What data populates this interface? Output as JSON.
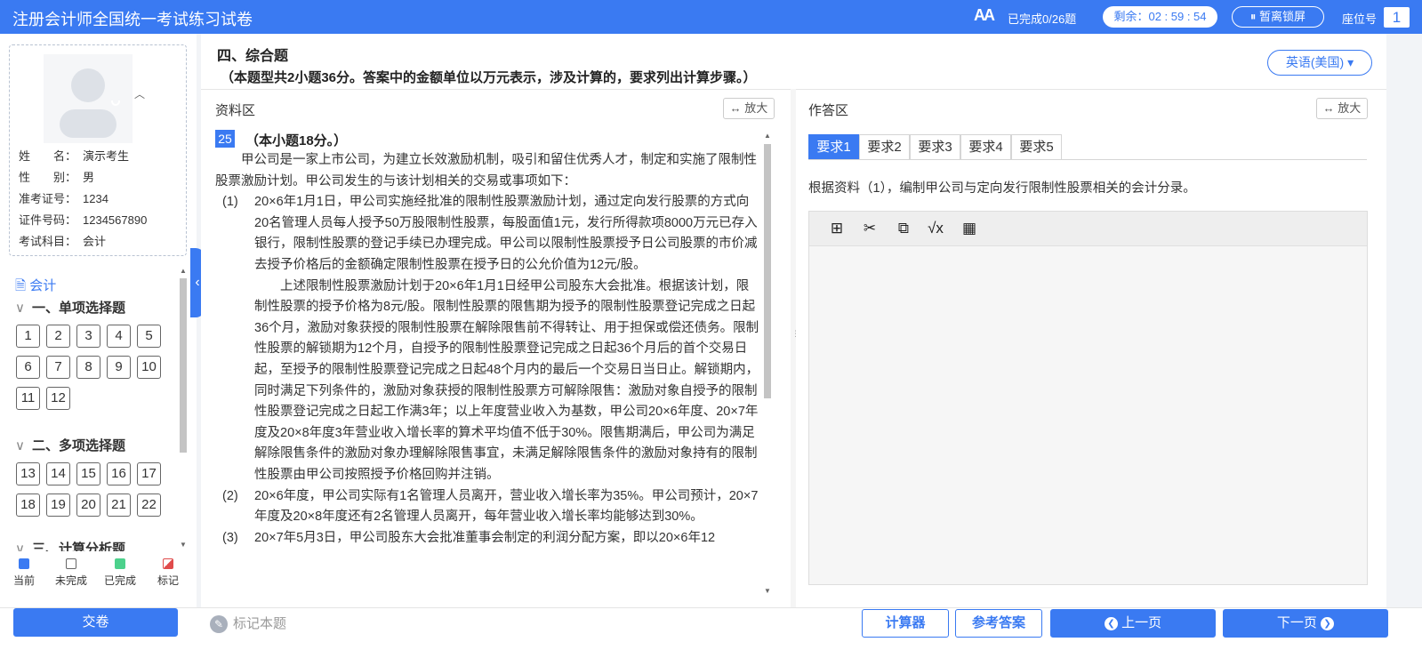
{
  "header": {
    "title": "注册会计师全国统一考试练习试卷",
    "font_size_icon": "AA",
    "progress_text": "已完成0/26题",
    "timer_text": "剩余：02 : 59 : 54",
    "lock_label": "暂离锁屏",
    "seat_label": "座位号",
    "seat_number": "1",
    "color_primary": "#3a7af2"
  },
  "profile": {
    "rows": [
      {
        "key": "姓　　名：",
        "value": "演示考生"
      },
      {
        "key": "性　　别：",
        "value": "男"
      },
      {
        "key": "准考证号：",
        "value": "1234"
      },
      {
        "key": "证件号码：",
        "value": "1234567890"
      },
      {
        "key": "考试科目：",
        "value": "会计"
      }
    ]
  },
  "nav": {
    "subject": "会计",
    "sections": [
      {
        "title": "一、单项选择题",
        "questions": [
          "1",
          "2",
          "3",
          "4",
          "5",
          "6",
          "7",
          "8",
          "9",
          "10",
          "11",
          "12"
        ]
      },
      {
        "title": "二、多项选择题",
        "questions": [
          "13",
          "14",
          "15",
          "16",
          "17",
          "18",
          "19",
          "20",
          "21",
          "22"
        ]
      },
      {
        "title": "三、计算分析题",
        "questions": []
      }
    ],
    "legend": [
      {
        "label": "当前",
        "color": "#3a7af2"
      },
      {
        "label": "未完成",
        "color": "#ffffff"
      },
      {
        "label": "已完成",
        "color": "#4cd18c"
      },
      {
        "label": "标记",
        "color": "#e04b4b"
      }
    ]
  },
  "question": {
    "section_title": "四、综合题",
    "section_note": "（本题型共2小题36分。答案中的金额单位以万元表示，涉及计算的，要求列出计算步骤。）",
    "language": "英语(美国)",
    "material_label": "资料区",
    "answer_label": "作答区",
    "zoom_label": "放大",
    "number": "25",
    "score": "（本小题18分。）",
    "intro": "甲公司是一家上市公司，为建立长效激励机制，吸引和留住优秀人才，制定和实施了限制性股票激励计划。甲公司发生的与该计划相关的交易或事项如下：",
    "items": [
      {
        "no": "(1)",
        "text": "20×6年1月1日，甲公司实施经批准的限制性股票激励计划，通过定向发行股票的方式向20名管理人员每人授予50万股限制性股票，每股面值1元，发行所得款项8000万元已存入银行，限制性股票的登记手续已办理完成。甲公司以限制性股票授予日公司股票的市价减去授予价格后的金额确定限制性股票在授予日的公允价值为12元/股。"
      },
      {
        "no": "",
        "text": "上述限制性股票激励计划于20×6年1月1日经甲公司股东大会批准。根据该计划，限制性股票的授予价格为8元/股。限制性股票的限售期为授予的限制性股票登记完成之日起36个月，激励对象获授的限制性股票在解除限售前不得转让、用于担保或偿还债务。限制性股票的解锁期为12个月，自授予的限制性股票登记完成之日起36个月后的首个交易日起，至授予的限制性股票登记完成之日起48个月内的最后一个交易日当日止。解锁期内，同时满足下列条件的，激励对象获授的限制性股票方可解除限售：激励对象自授予的限制性股票登记完成之日起工作满3年；以上年度营业收入为基数，甲公司20×6年度、20×7年度及20×8年度3年营业收入增长率的算术平均值不低于30%。限售期满后，甲公司为满足解除限售条件的激励对象办理解除限售事宜，未满足解除限售条件的激励对象持有的限制性股票由甲公司按照授予价格回购并注销。"
      },
      {
        "no": "(2)",
        "text": "20×6年度，甲公司实际有1名管理人员离开，营业收入增长率为35%。甲公司预计，20×7年度及20×8年度还有2名管理人员离开，每年营业收入增长率均能够达到30%。"
      },
      {
        "no": "(3)",
        "text": "20×7年5月3日，甲公司股东大会批准董事会制定的利润分配方案，即以20×6年12"
      }
    ],
    "tabs": [
      "要求1",
      "要求2",
      "要求3",
      "要求4",
      "要求5"
    ],
    "requirement": "根据资料（1），编制甲公司与定向发行限制性股票相关的会计分录。"
  },
  "editor_tools": [
    "insert-icon",
    "cut-icon",
    "copy-icon",
    "formula-icon",
    "table-icon"
  ],
  "footer": {
    "submit": "交卷",
    "mark": "标记本题",
    "calculator": "计算器",
    "reference": "参考答案",
    "prev": "上一页",
    "next": "下一页"
  }
}
